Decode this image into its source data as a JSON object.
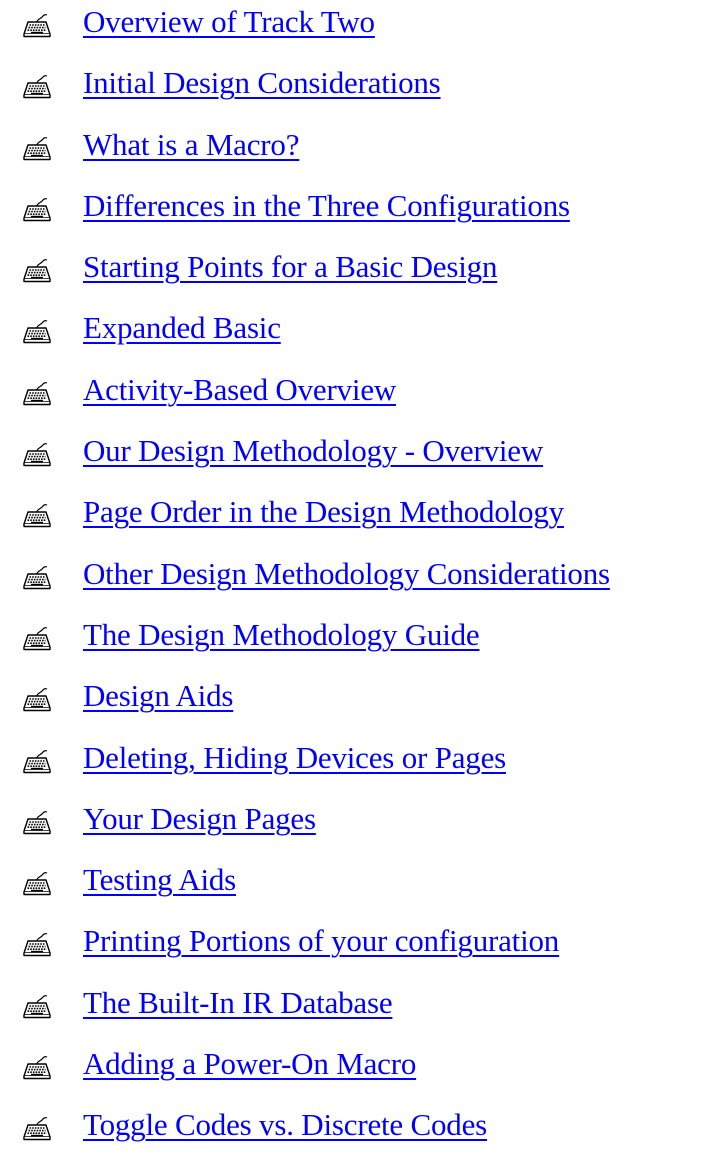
{
  "toc": {
    "link_color": "#0000ff",
    "bullet_icon": "keyboard-icon",
    "items": [
      {
        "label": "Overview of Track Two"
      },
      {
        "label": "Initial Design Considerations"
      },
      {
        "label": "What is a Macro?"
      },
      {
        "label": "Differences in the Three Configurations"
      },
      {
        "label": "Starting Points for a Basic Design"
      },
      {
        "label": "Expanded Basic"
      },
      {
        "label": "Activity-Based Overview"
      },
      {
        "label": "Our Design Methodology - Overview"
      },
      {
        "label": "Page Order in the Design Methodology"
      },
      {
        "label": "Other Design Methodology Considerations"
      },
      {
        "label": "The Design Methodology Guide"
      },
      {
        "label": "Design Aids"
      },
      {
        "label": "Deleting, Hiding Devices or Pages"
      },
      {
        "label": "Your Design Pages"
      },
      {
        "label": "Testing Aids"
      },
      {
        "label": "Printing Portions of your configuration"
      },
      {
        "label": "The Built-In IR Database"
      },
      {
        "label": "Adding a Power-On Macro"
      },
      {
        "label": "Toggle Codes vs. Discrete Codes"
      }
    ]
  }
}
